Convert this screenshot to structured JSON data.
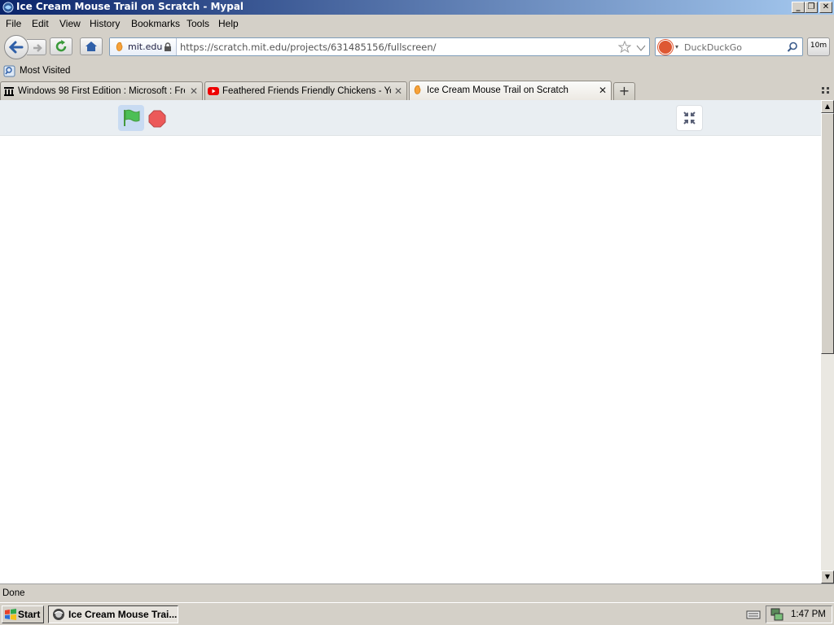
{
  "window": {
    "title": "Ice Cream Mouse Trail on Scratch - Mypal"
  },
  "menu": [
    {
      "label": "File"
    },
    {
      "label": "Edit"
    },
    {
      "label": "View"
    },
    {
      "label": "History"
    },
    {
      "label": "Bookmarks"
    },
    {
      "label": "Tools"
    },
    {
      "label": "Help"
    }
  ],
  "nav": {
    "identity_site": "mit.edu",
    "url": "https://scratch.mit.edu/projects/631485156/fullscreen/",
    "search_placeholder": "DuckDuckGo",
    "addon_label": "10m"
  },
  "bookmarks": [
    {
      "label": "Most Visited"
    }
  ],
  "tabs": [
    {
      "label": "Windows 98 First Edition : Microsoft : Fre...",
      "close": "✕"
    },
    {
      "label": "Feathered Friends Friendly Chickens - Yo...",
      "close": "✕"
    },
    {
      "label": "Ice Cream Mouse Trail on Scratch",
      "close": "✕"
    }
  ],
  "newtab_label": "+",
  "status": {
    "text": "Done"
  },
  "taskbar": {
    "start_label": "Start",
    "task_label": "Ice Cream Mouse Trai...",
    "clock": "1:47 PM"
  },
  "colors": {
    "green_flag": "#4cbf56",
    "stop": "#ec5959",
    "player_bar": "#e9eef2"
  },
  "icons": {
    "window": "firefox-like-icon",
    "back": "arrow-left-icon",
    "forward": "arrow-right-icon",
    "reload": "reload-icon",
    "home": "home-icon",
    "padlock": "lock-icon",
    "star": "star-icon",
    "search": "magnifier-icon"
  }
}
